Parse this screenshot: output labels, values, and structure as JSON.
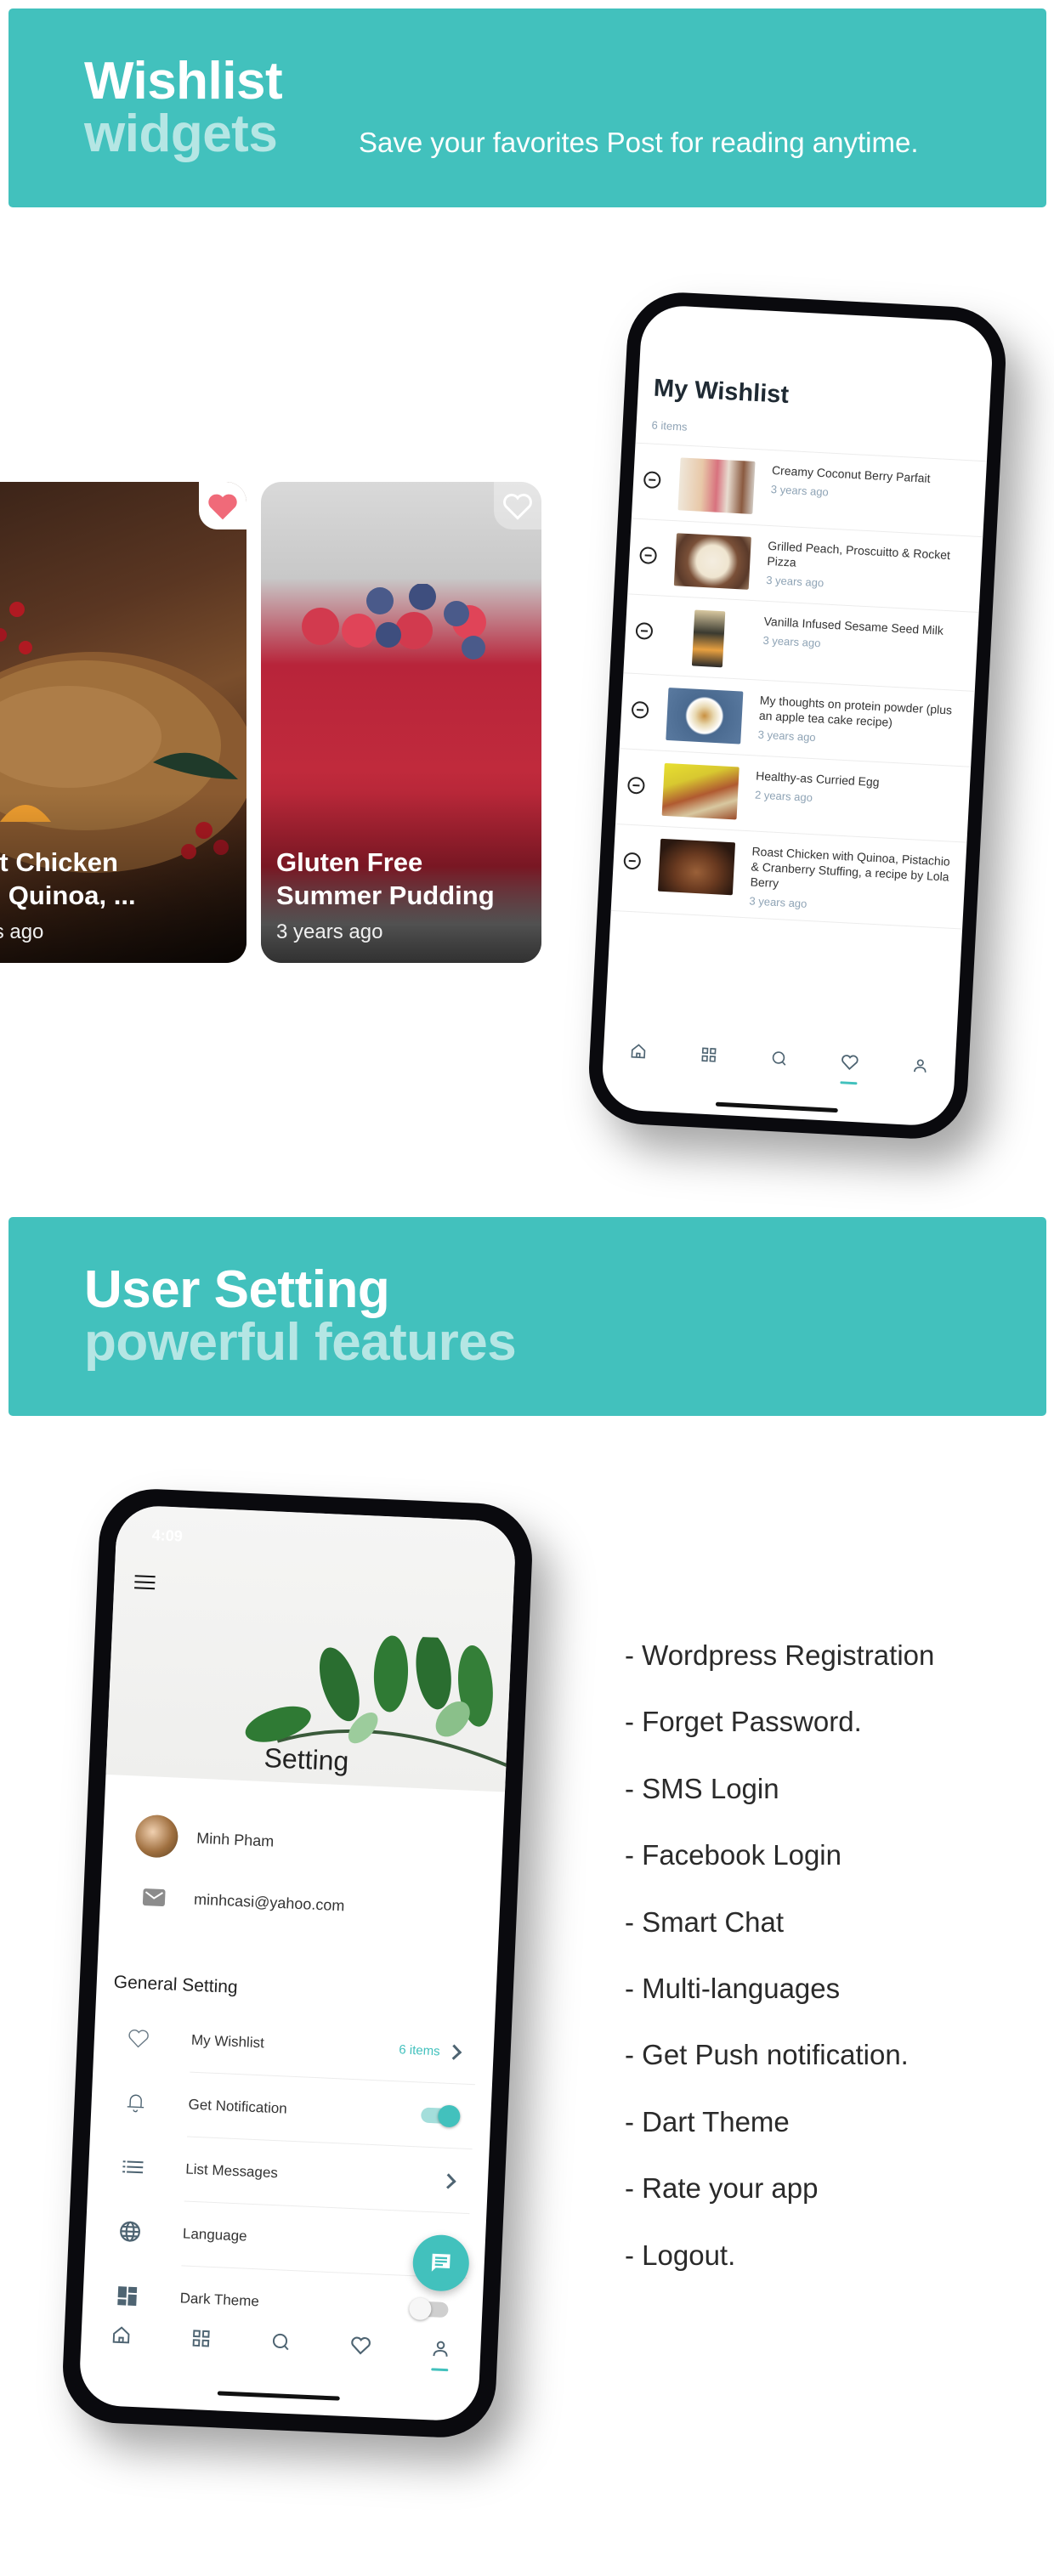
{
  "colors": {
    "accent": "#42c1bd",
    "accent_light": "#b5e6e4",
    "favorite": "#f06a79",
    "text_dark": "#222222",
    "muted": "#8ea3b5"
  },
  "wishlist_banner": {
    "title_line1": "Wishlist",
    "title_line2": "widgets",
    "subtitle": "Save your favorites Post for reading anytime."
  },
  "cards": [
    {
      "title": "oast Chicken with Quinoa, ...",
      "title_line1": "oast Chicken",
      "title_line2": "vith Quinoa, ...",
      "date": "years ago",
      "favorited": true,
      "icon": "heart-filled-icon"
    },
    {
      "title": "Gluten Free Summer Pudding",
      "title_line1": "Gluten Free",
      "title_line2": "Summer Pudding",
      "date": "3 years ago",
      "favorited": false,
      "icon": "heart-outline-icon"
    }
  ],
  "wishlist_screen": {
    "title": "My Wishlist",
    "count": "6 items",
    "items": [
      {
        "name": "Creamy Coconut Berry Parfait",
        "ago": "3 years ago"
      },
      {
        "name": "Grilled Peach, Proscuitto & Rocket Pizza",
        "ago": "3 years ago"
      },
      {
        "name": "Vanilla Infused Sesame Seed Milk",
        "ago": "3 years ago"
      },
      {
        "name": "My thoughts on protein powder (plus an apple tea cake recipe)",
        "ago": "3 years ago"
      },
      {
        "name": "Healthy-as Curried Egg",
        "ago": "2 years ago"
      },
      {
        "name": "Roast Chicken with Quinoa, Pistachio & Cranberry Stuffing, a recipe by Lola Berry",
        "ago": "3 years ago"
      }
    ],
    "nav": [
      "home-icon",
      "grid-icon",
      "search-icon",
      "heart-icon",
      "user-icon"
    ],
    "nav_active": "heart-icon"
  },
  "settings_banner": {
    "title_line1": "User Setting",
    "title_line2": "powerful features"
  },
  "settings_screen": {
    "status_time": "4:09",
    "title": "Setting",
    "user_name": "Minh Pham",
    "email": "minhcasi@yahoo.com",
    "section_title": "General Setting",
    "items": [
      {
        "label": "My Wishlist",
        "value": "6 items",
        "control": "chevron",
        "icon": "heart-outline-icon"
      },
      {
        "label": "Get Notification",
        "value": "",
        "control": "toggle",
        "toggle_on": true,
        "icon": "bell-icon"
      },
      {
        "label": "List Messages",
        "value": "",
        "control": "chevron",
        "icon": "list-icon"
      },
      {
        "label": "Language",
        "value": "",
        "control": "chevron",
        "icon": "globe-icon"
      },
      {
        "label": "Dark Theme",
        "value": "",
        "control": "toggle",
        "toggle_on": false,
        "icon": "dashboard-icon"
      }
    ],
    "fab_icon": "chat-icon",
    "nav": [
      "home-icon",
      "grid-icon",
      "search-icon",
      "heart-icon",
      "user-icon"
    ],
    "nav_active": "user-icon"
  },
  "features": [
    "- Wordpress Registration",
    "- Forget Password.",
    "- SMS Login",
    "- Facebook Login",
    "- Smart Chat",
    "- Multi-languages",
    "- Get Push notification.",
    "- Dart Theme",
    "- Rate your app",
    "- Logout."
  ]
}
